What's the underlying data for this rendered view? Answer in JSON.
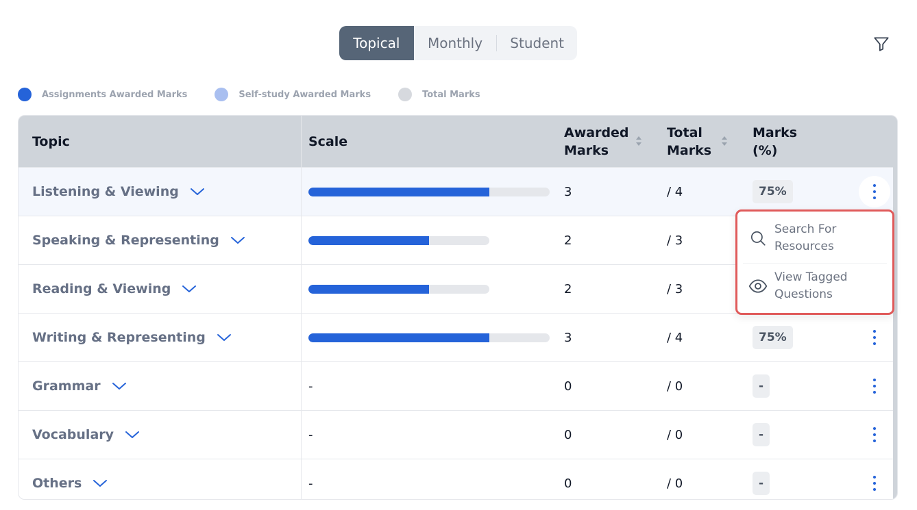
{
  "tabs": [
    {
      "label": "Topical",
      "active": true
    },
    {
      "label": "Monthly",
      "active": false
    },
    {
      "label": "Student",
      "active": false
    }
  ],
  "filter_icon": "filter-icon",
  "legend": [
    {
      "label": "Assignments Awarded Marks",
      "color": "#2563d9"
    },
    {
      "label": "Self-study Awarded Marks",
      "color": "#a9bff0"
    },
    {
      "label": "Total Marks",
      "color": "#d6d9de"
    }
  ],
  "table": {
    "headers": {
      "topic": "Topic",
      "scale": "Scale",
      "awarded_line1": "Awarded",
      "awarded_line2": "Marks",
      "total_line1": "Total",
      "total_line2": "Marks",
      "pct_line1": "Marks",
      "pct_line2": "(%)"
    },
    "rows": [
      {
        "topic": "Listening & Viewing",
        "scale": "",
        "awarded": "3",
        "total": "/ 4",
        "percent": "75%",
        "progress": 0.75,
        "max_marks": 4
      },
      {
        "topic": "Speaking & Representing",
        "scale": "",
        "awarded": "2",
        "total": "/ 3",
        "percent": "",
        "progress": 0.667,
        "max_marks": 3
      },
      {
        "topic": "Reading & Viewing",
        "scale": "",
        "awarded": "2",
        "total": "/ 3",
        "percent": "",
        "progress": 0.667,
        "max_marks": 3
      },
      {
        "topic": "Writing & Representing",
        "scale": "",
        "awarded": "3",
        "total": "/ 4",
        "percent": "75%",
        "progress": 0.75,
        "max_marks": 4
      },
      {
        "topic": "Grammar",
        "scale": "-",
        "awarded": "0",
        "total": "/ 0",
        "percent": "-"
      },
      {
        "topic": "Vocabulary",
        "scale": "-",
        "awarded": "0",
        "total": "/ 0",
        "percent": "-"
      },
      {
        "topic": "Others",
        "scale": "-",
        "awarded": "0",
        "total": "/ 0",
        "percent": "-"
      }
    ]
  },
  "dropdown": {
    "items": [
      {
        "label_line1": "Search For",
        "label_line2": "Resources",
        "icon": "search-icon"
      },
      {
        "label_line1": "View Tagged",
        "label_line2": "Questions",
        "icon": "eye-icon"
      }
    ]
  },
  "colors": {
    "accent": "#2563d9",
    "tab_active": "#566577",
    "header_bg": "#cfd4da",
    "highlight_border": "#e05a5a"
  }
}
